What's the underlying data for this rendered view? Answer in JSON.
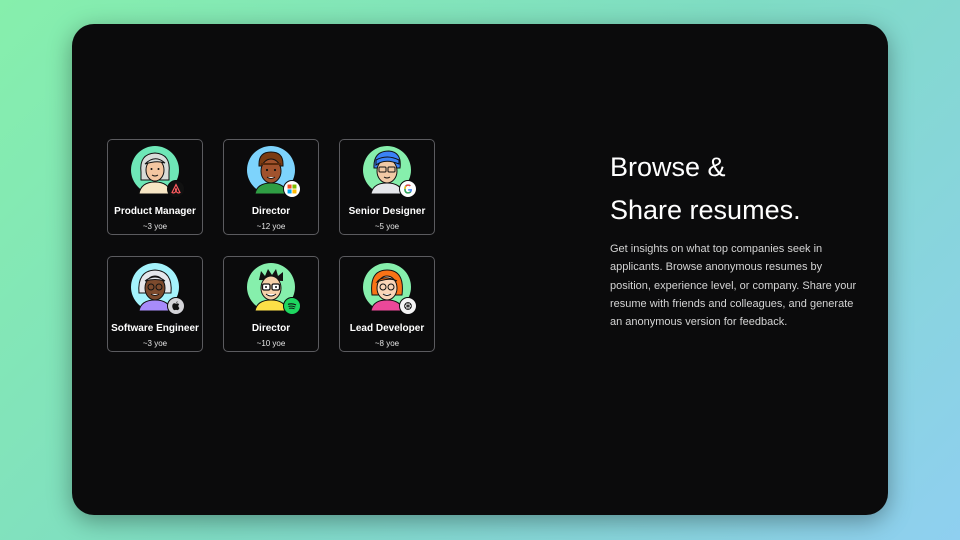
{
  "hero": {
    "title_line1": "Browse &",
    "title_line2": "Share resumes.",
    "description": "Get insights on what top companies seek in applicants. Browse anonymous resumes by position, experience level, or company. Share your resume with friends and colleagues, and generate an anonymous version for feedback."
  },
  "colors": {
    "panel_background": "#0b0b0c",
    "card_border": "#5b5b5f",
    "text_primary": "#ffffff",
    "page_gradient": [
      "#86efac",
      "#8fcff0"
    ]
  },
  "resume_cards": [
    {
      "role": "Product Manager",
      "experience": "~3 yoe",
      "company_icon": "airbnb-icon",
      "avatar_bg": "#6ee7b7"
    },
    {
      "role": "Director",
      "experience": "~12 yoe",
      "company_icon": "microsoft-icon",
      "avatar_bg": "#7dd3fc"
    },
    {
      "role": "Senior Designer",
      "experience": "~5 yoe",
      "company_icon": "google-icon",
      "avatar_bg": "#86efac"
    },
    {
      "role": "Software Engineer",
      "experience": "~3 yoe",
      "company_icon": "apple-icon",
      "avatar_bg": "#a5f3fc"
    },
    {
      "role": "Director",
      "experience": "~10 yoe",
      "company_icon": "spotify-icon",
      "avatar_bg": "#86efac"
    },
    {
      "role": "Lead Developer",
      "experience": "~8 yoe",
      "company_icon": "openai-icon",
      "avatar_bg": "#86efac"
    }
  ]
}
